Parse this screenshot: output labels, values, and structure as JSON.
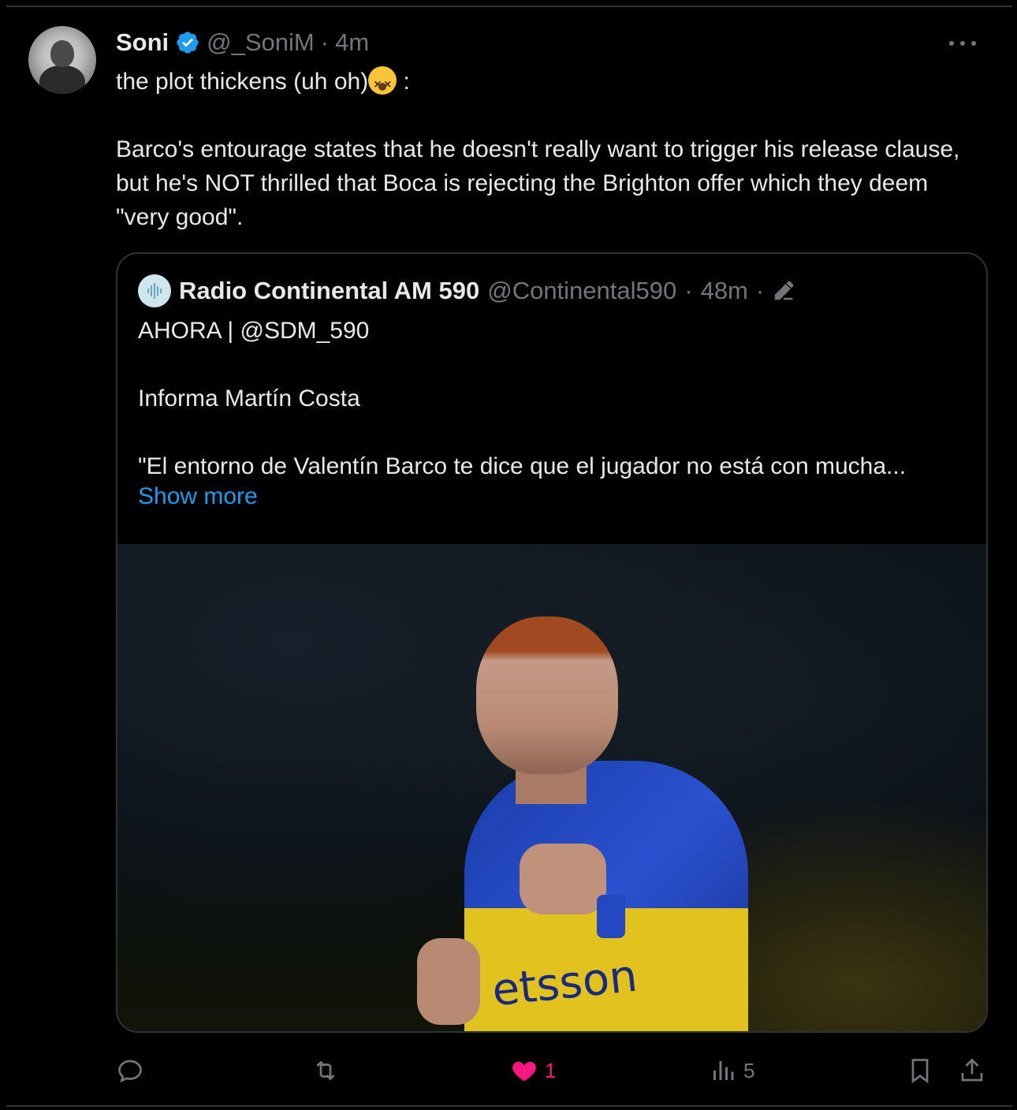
{
  "tweet": {
    "author": {
      "display_name": "Soni",
      "handle": "@_SoniM",
      "separator": "·",
      "time": "4m"
    },
    "text_line1": "the plot thickens (uh oh)",
    "text_line1_suffix": " :",
    "text_body": "Barco's entourage states that he doesn't really want to trigger his release clause, but he's NOT thrilled that Boca is rejecting the Brighton offer which they deem \"very good\".",
    "emoji_name": "dizzy-face-emoji"
  },
  "quote": {
    "author": {
      "display_name": "Radio Continental AM 590",
      "handle": "@Continental590",
      "separator": "·",
      "time": "48m",
      "separator2": "·"
    },
    "text": "AHORA | @SDM_590\n\nInforma Martín Costa\n\n\"El entorno de Valentín Barco te dice que el jugador no está con mucha...",
    "show_more": "Show more",
    "media": {
      "sponsor_text": "etsson"
    }
  },
  "actions": {
    "reply": {
      "icon": "reply-icon"
    },
    "retweet": {
      "icon": "retweet-icon"
    },
    "like": {
      "icon": "heart-filled-icon",
      "count": "1"
    },
    "views": {
      "icon": "views-icon",
      "count": "5"
    },
    "bookmark": {
      "icon": "bookmark-icon"
    },
    "share": {
      "icon": "share-icon"
    }
  },
  "colors": {
    "background": "#000000",
    "text": "#e7e9ea",
    "secondary": "#71767b",
    "accent": "#1d9bf0",
    "like": "#f91880",
    "border": "#2f3336"
  }
}
